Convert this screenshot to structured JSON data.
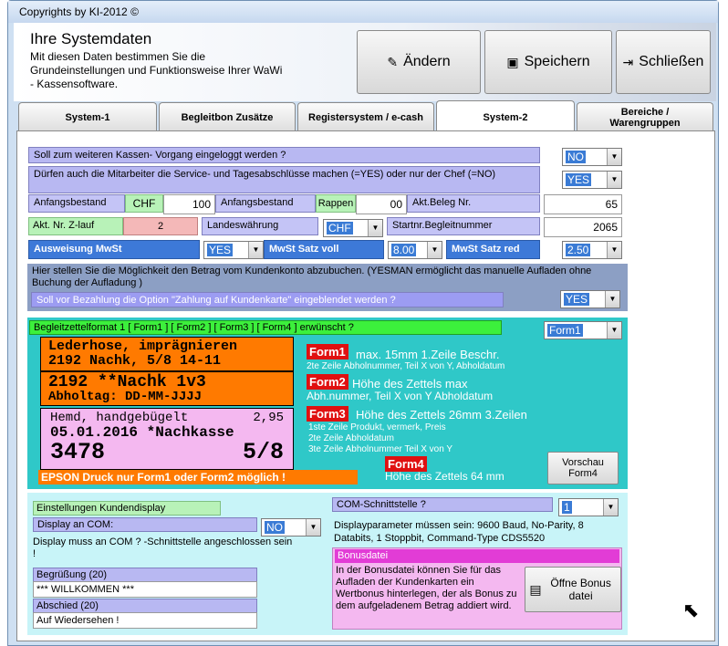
{
  "window": {
    "title": "Copyrights by KI-2012 ©"
  },
  "header": {
    "title": "Ihre Systemdaten",
    "description": "Mit diesen Daten bestimmen Sie die Grundeinstellungen und Funktionsweise Ihrer WaWi - Kassensoftware.",
    "buttons": {
      "edit": "Ändern",
      "save": "Speichern",
      "close": "Schließen"
    }
  },
  "tabs": [
    {
      "label": "System-1"
    },
    {
      "label": "Begleitbon Zusätze"
    },
    {
      "label": "Registersystem / e-cash"
    },
    {
      "label": "System-2"
    },
    {
      "label": "Bereiche / Warengruppen"
    }
  ],
  "general": {
    "login_question": "Soll zum weiteren  Kassen- Vorgang  eingeloggt werden ?",
    "login_value": "NO",
    "staff_question": "Dürfen auch die Mitarbeiter die Service- und Tagesabschlüsse machen (=YES) oder nur     der Chef (=NO)",
    "staff_value": "YES",
    "opening_label": "Anfangsbestand",
    "opening_currency": "CHF",
    "opening_value": "100",
    "opening2_label": "Anfangsbestand",
    "opening2_currency": "Rappen",
    "opening2_value": "00",
    "receipt_label": "Akt.Beleg Nr.",
    "receipt_value": "65",
    "zrun_label": "Akt. Nr. Z-lauf",
    "zrun_value": "2",
    "currency_label": "Landeswährung",
    "currency_value": "CHF",
    "start_label": "Startnr.Begleitnummer",
    "start_value": "2065",
    "vat_label": "Ausweisung MwSt",
    "vat_value": "YES",
    "vat_full_label": "MwSt Satz voll",
    "vat_full_value": "8.00",
    "vat_red_label": "MwSt Satz red",
    "vat_red_value": "2.50"
  },
  "customer_account": {
    "info": "Hier stellen Sie die Möglichkeit den Betrag  vom Kundenkonto abzubuchen. (YESMAN ermöglicht das manuelle Aufladen ohne Buchung der Aufladung )",
    "question": "Soll vor Bezahlung die Option \"Zahlung auf Kundenkarte\" eingeblendet werden ?",
    "value": "YES"
  },
  "label_format": {
    "question": "Begleitzettelformat 1 [ Form1 ] [ Form2 ] [ Form3 ] [ Form4 ] erwünscht ?",
    "value": "Form1",
    "sample1": {
      "line1": "Lederhose, imprägnieren",
      "line2": "2192 Nachk, 5/8  14-11"
    },
    "sample2": {
      "line1": "2192 **Nachk  1v3",
      "line2": "Abholtag: DD-MM-JJJJ"
    },
    "sample3": {
      "line1": "Hemd, handgebügelt",
      "price": "2,95",
      "line2": "05.01.2016 *Nachkasse",
      "num": "3478",
      "frac": "5/8"
    },
    "epson_note": "EPSON Druck nur Form1 oder Form2 möglich !",
    "form1_tag": "Form1",
    "form1_text1": "max. 15mm  1.Zeile  Beschr.",
    "form1_text2": "2te Zeile Abholnummer, Teil X von Y, Abholdatum",
    "form2_tag": "Form2",
    "form2_text1": "Höhe des Zettels max",
    "form2_text2": "Abh.nummer, Teil X von Y Abholdatum",
    "form3_tag": "Form3",
    "form3_text1": "Höhe des Zettels 26mm 3.Zeilen",
    "form3_text2": "1ste Zeile Produkt, vermerk, Preis",
    "form3_text3": "2te Zeile Abholdatum",
    "form3_text4": "3te Zeile Abholnummer Teil X von Y",
    "form4_tag": "Form4",
    "form4_text": "Höhe des Zettels 64 mm",
    "preview_button": "Vorschau Form4"
  },
  "display": {
    "settings_label": "Einstellungen Kundendisplay",
    "com_label": "Display an COM:",
    "com_value": "NO",
    "com_note": "Display muss an COM ? -Schnittstelle angeschlossen sein !",
    "greeting_label": "Begrüßung (20)",
    "greeting_value": "*** WILLKOMMEN ***",
    "farewell_label": "Abschied (20)",
    "farewell_value": "Auf Wiedersehen !",
    "com_port_label": "COM-Schnittstelle  ?",
    "com_port_value": "1",
    "params": "Displayparameter müssen sein: 9600 Baud, No-Parity, 8 Databits, 1 Stoppbit, Command-Type CDS5520"
  },
  "bonus": {
    "title": "Bonusdatei",
    "text": "In der Bonusdatei können Sie für das Aufladen der Kundenkarten ein Wertbonus hinterlegen, der als Bonus zu dem aufgeladenem Betrag  addiert wird.",
    "button": "Öffne Bonus datei"
  },
  "colors": {
    "accent": "#3a7bd5",
    "purple_label": "#b8b8f2",
    "teal": "#2fc8c8",
    "orange": "#ff7a00",
    "pink": "#f4b8f0"
  }
}
